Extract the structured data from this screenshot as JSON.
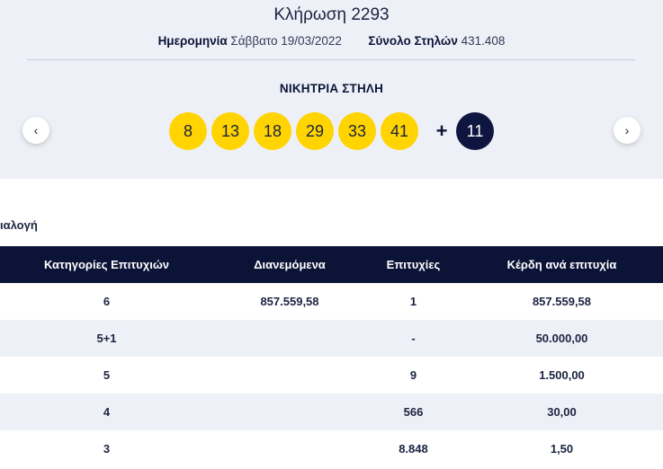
{
  "draw": {
    "title": "Κλήρωση 2293",
    "date_label": "Ημερομηνία",
    "date_value": "Σάββατο 19/03/2022",
    "columns_label": "Σύνολο Στηλών",
    "columns_value": "431.408"
  },
  "winning": {
    "label": "ΝΙΚΗΤΡΙΑ ΣΤΗΛΗ",
    "numbers": [
      "8",
      "13",
      "18",
      "29",
      "33",
      "41"
    ],
    "plus": "+",
    "joker": "11"
  },
  "nav": {
    "prev": "‹",
    "next": "›"
  },
  "section": {
    "label": "ιαλογή"
  },
  "table": {
    "headers": [
      "Κατηγορίες Επιτυχιών",
      "Διανεμόμενα",
      "Επιτυχίες",
      "Κέρδη ανά επιτυχία"
    ],
    "rows": [
      [
        "6",
        "857.559,58",
        "1",
        "857.559,58"
      ],
      [
        "5+1",
        "",
        "-",
        "50.000,00"
      ],
      [
        "5",
        "",
        "9",
        "1.500,00"
      ],
      [
        "4",
        "",
        "566",
        "30,00"
      ],
      [
        "3",
        "",
        "8.848",
        "1,50"
      ]
    ]
  }
}
